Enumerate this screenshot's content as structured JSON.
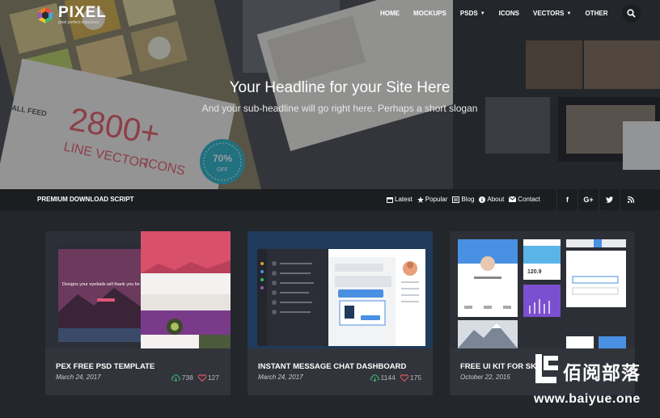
{
  "brand": {
    "name": "PIXEL",
    "tagline": "pixel perfect resources"
  },
  "nav": {
    "items": [
      {
        "label": "HOME",
        "dropdown": false
      },
      {
        "label": "MOCKUPS",
        "dropdown": false
      },
      {
        "label": "PSDS",
        "dropdown": true
      },
      {
        "label": "ICONS",
        "dropdown": false
      },
      {
        "label": "VECTORS",
        "dropdown": true
      },
      {
        "label": "OTHER",
        "dropdown": false
      }
    ],
    "search_icon": "search-icon"
  },
  "hero": {
    "title": "Your Headline for your Site Here",
    "subtitle": "And your sub-headline will go right here. Perhaps a short slogan",
    "bg_text": {
      "all_feed": "ALL FEED",
      "big": "2800+",
      "line1": "LINE VECTOR",
      "line2": "ICONS",
      "badge_pct": "70%",
      "badge_off": "OFF"
    }
  },
  "subbar": {
    "title": "PREMIUM DOWNLOAD SCRIPT",
    "links": [
      {
        "label": "Latest",
        "icon": "calendar-icon"
      },
      {
        "label": "Popular",
        "icon": "star-icon"
      },
      {
        "label": "Blog",
        "icon": "blog-icon"
      },
      {
        "label": "About",
        "icon": "info-icon"
      },
      {
        "label": "Contact",
        "icon": "envelope-icon"
      }
    ],
    "social": [
      {
        "glyph": "f",
        "icon": "facebook-icon"
      },
      {
        "glyph": "G+",
        "icon": "google-plus-icon"
      },
      {
        "glyph": "t",
        "icon": "twitter-icon"
      },
      {
        "glyph": "rss",
        "icon": "rss-icon"
      }
    ]
  },
  "cards": [
    {
      "title": "PEX FREE PSD TEMPLATE",
      "date": "March 24, 2017",
      "downloads": "738",
      "likes": "127",
      "thumb": {
        "headline": "Designs your eyeballs will thank you for"
      }
    },
    {
      "title": "INSTANT MESSAGE CHAT DASHBOARD",
      "date": "March 24, 2017",
      "downloads": "1144",
      "likes": "175"
    },
    {
      "title": "FREE UI KIT FOR SK",
      "date": "October 22, 2015",
      "downloads": "",
      "likes": "",
      "thumb": {
        "stat": "120.9"
      }
    }
  ],
  "watermark": {
    "cn": "佰阅部落",
    "url": "www.baiyue.one"
  },
  "colors": {
    "page_bg": "#23262b",
    "bar_bg": "#1b1d21",
    "card_bg": "#31343a",
    "download": "#3cba6d",
    "like": "#e8556a",
    "accent": "#4a90e2"
  }
}
